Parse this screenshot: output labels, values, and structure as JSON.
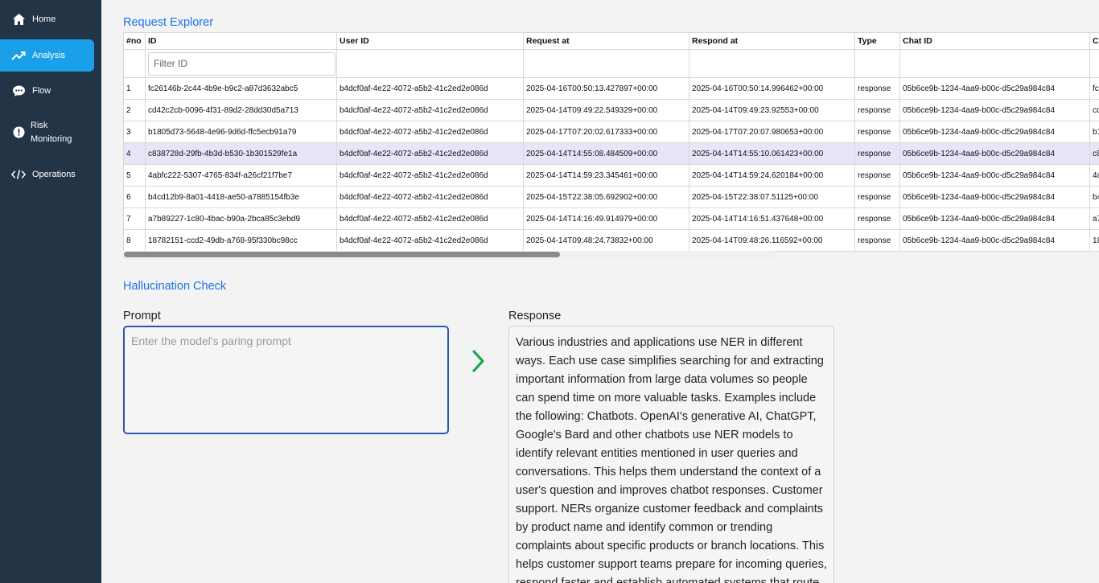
{
  "sidebar": {
    "items": [
      {
        "label": "Home",
        "icon": "home-icon"
      },
      {
        "label": "Analysis",
        "icon": "trend-icon",
        "active": true
      },
      {
        "label": "Flow",
        "icon": "chat-icon"
      },
      {
        "label": "Risk\nMonitoring",
        "icon": "alert-icon"
      },
      {
        "label": "Operations",
        "icon": "code-icon"
      }
    ]
  },
  "request_explorer": {
    "title": "Request Explorer",
    "columns": [
      "#no",
      "ID",
      "User ID",
      "Request at",
      "Respond at",
      "Type",
      "Chat ID",
      "C"
    ],
    "filter_placeholder": "Filter ID",
    "rows": [
      [
        "1",
        "fc26146b-2c44-4b9e-b9c2-a87d3632abc5",
        "b4dcf0af-4e22-4072-a5b2-41c2ed2e086d",
        "2025-04-16T00:50:13.427897+00:00",
        "2025-04-16T00:50:14.996462+00:00",
        "response",
        "05b6ce9b-1234-4aa9-b00c-d5c29a984c84",
        "fc"
      ],
      [
        "2",
        "cd42c2cb-0096-4f31-89d2-28dd30d5a713",
        "b4dcf0af-4e22-4072-a5b2-41c2ed2e086d",
        "2025-04-14T09:49:22.549329+00:00",
        "2025-04-14T09:49:23.92553+00:00",
        "response",
        "05b6ce9b-1234-4aa9-b00c-d5c29a984c84",
        "cd"
      ],
      [
        "3",
        "b1805d73-5648-4e96-9d6d-ffc5ecb91a79",
        "b4dcf0af-4e22-4072-a5b2-41c2ed2e086d",
        "2025-04-17T07:20:02.617333+00:00",
        "2025-04-17T07:20:07.980653+00:00",
        "response",
        "05b6ce9b-1234-4aa9-b00c-d5c29a984c84",
        "b1"
      ],
      [
        "4",
        "c838728d-29fb-4b3d-b530-1b301529fe1a",
        "b4dcf0af-4e22-4072-a5b2-41c2ed2e086d",
        "2025-04-14T14:55:08.484509+00:00",
        "2025-04-14T14:55:10.061423+00:00",
        "response",
        "05b6ce9b-1234-4aa9-b00c-d5c29a984c84",
        "c8"
      ],
      [
        "5",
        "4abfc222-5307-4765-834f-a26cf21f7be7",
        "b4dcf0af-4e22-4072-a5b2-41c2ed2e086d",
        "2025-04-14T14:59:23.345461+00:00",
        "2025-04-14T14:59:24.620184+00:00",
        "response",
        "05b6ce9b-1234-4aa9-b00c-d5c29a984c84",
        "4a"
      ],
      [
        "6",
        "b4cd12b9-8a01-4418-ae50-a7885154fb3e",
        "b4dcf0af-4e22-4072-a5b2-41c2ed2e086d",
        "2025-04-15T22:38:05.692902+00:00",
        "2025-04-15T22:38:07.51125+00:00",
        "response",
        "05b6ce9b-1234-4aa9-b00c-d5c29a984c84",
        "b4"
      ],
      [
        "7",
        "a7b89227-1c80-4bac-b90a-2bca85c3ebd9",
        "b4dcf0af-4e22-4072-a5b2-41c2ed2e086d",
        "2025-04-14T14:16:49.914979+00:00",
        "2025-04-14T14:16:51.437648+00:00",
        "response",
        "05b6ce9b-1234-4aa9-b00c-d5c29a984c84",
        "a7"
      ],
      [
        "8",
        "18782151-ccd2-49db-a768-95f330bc98cc",
        "b4dcf0af-4e22-4072-a5b2-41c2ed2e086d",
        "2025-04-14T09:48:24.73832+00:00",
        "2025-04-14T09:48:26.116592+00:00",
        "response",
        "05b6ce9b-1234-4aa9-b00c-d5c29a984c84",
        "18"
      ]
    ],
    "selected_row": 4
  },
  "hallucination_check": {
    "title": "Hallucination Check",
    "prompt_label": "Prompt",
    "prompt_placeholder": "Enter the model's paring prompt",
    "response_label": "Response",
    "response_text": "Various industries and applications use NER in different ways. Each use case simplifies searching for and extracting important information from large data volumes so people can spend time on more valuable tasks. Examples include the following: Chatbots. OpenAI's generative AI, ChatGPT, Google's Bard and other chatbots use NER models to identify relevant entities mentioned in user queries and conversations. This helps them understand the context of a user's question and improves chatbot responses. Customer support. NERs organize customer feedback and complaints by product name and identify common or trending complaints about specific products or branch locations. This helps customer support teams prepare for incoming queries, respond faster and establish automated systems that route"
  },
  "colors": {
    "sidebar_bg": "#243447",
    "active_item": "#1aa0e8",
    "title_blue": "#1a73e8",
    "arrow_green": "#1fa84f",
    "selected_row": "#e6e6f8"
  }
}
